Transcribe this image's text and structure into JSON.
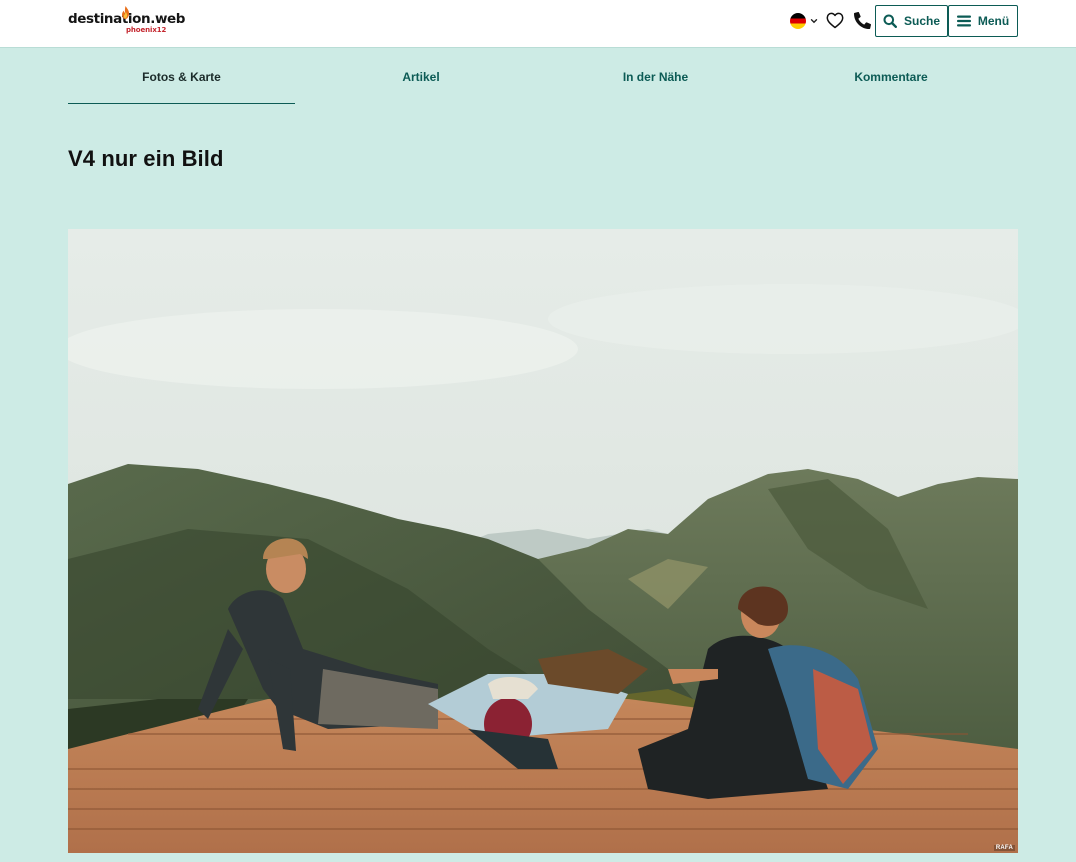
{
  "header": {
    "logo": {
      "brand": "destination.web",
      "sub": "phoenix12"
    },
    "language": {
      "current": "de",
      "flag": "germany-flag"
    },
    "search_label": "Suche",
    "menu_label": "Menü",
    "icons": [
      "heart-icon",
      "phone-icon",
      "search-icon",
      "hamburger-icon",
      "chevron-down-icon"
    ],
    "accent_color": "#0c5b55"
  },
  "tabs": [
    {
      "label": "Fotos & Karte",
      "active": true
    },
    {
      "label": "Artikel",
      "active": false
    },
    {
      "label": "In der Nähe",
      "active": false
    },
    {
      "label": "Kommentare",
      "active": false
    }
  ],
  "page": {
    "title": "V4 nur ein Bild",
    "background_color": "#cdebe5"
  },
  "photo": {
    "credit": "RAFA"
  }
}
